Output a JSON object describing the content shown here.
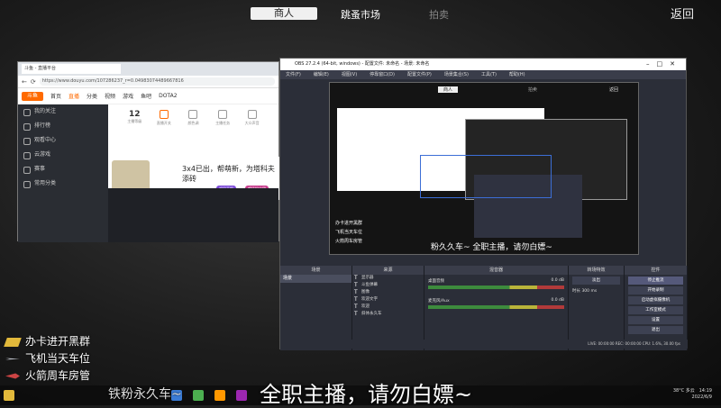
{
  "topbar": {
    "tabs": [
      "商人",
      "跳蚤市场",
      "拍卖"
    ],
    "back": "返回"
  },
  "browser": {
    "tab_title": "斗鱼 - 直播平台",
    "url": "https://www.douyu.com/107286237_r=0.04983074489667816",
    "nav": [
      "首页",
      "直播",
      "分类",
      "视频",
      "游戏",
      "鱼吧",
      "DOTA2"
    ],
    "sidebar": [
      "我的关注",
      "排行榜",
      "观看中心",
      "云游戏",
      "赛事",
      "常用分类"
    ],
    "stats": [
      {
        "num": "12",
        "label": "主播等级"
      },
      {
        "num": "",
        "label": "直播开关"
      },
      {
        "num": "",
        "label": "颜色调"
      },
      {
        "num": "",
        "label": "主播任务"
      },
      {
        "num": "",
        "label": "大众声音"
      }
    ],
    "live_title": "3x4已出，帮萌新，为塔科夫添砖",
    "pills": [
      "福星高照",
      "超级粉丝团"
    ]
  },
  "obs": {
    "title": "OBS 27.2.4 (64-bit, windows) - 配置文件: 未命名 - 场景: 未命名",
    "menu": [
      "文件(F)",
      "编辑(E)",
      "视图(V)",
      "停靠窗口(D)",
      "配置文件(P)",
      "场景集合(S)",
      "工具(T)",
      "帮助(H)"
    ],
    "preview_tabs": [
      "商人",
      "拍卖",
      "返回"
    ],
    "preview_lines": [
      "办卡进开黑群",
      "飞机当天车位",
      "火箭周车房管"
    ],
    "preview_caption": "粉久久车~  全职主播，请勿白嫖~",
    "panels": {
      "scenes": "场景",
      "sources": "来源",
      "mixer": "混音器",
      "transitions": "转场特效",
      "controls": "控件"
    },
    "scene_items": [
      "场景"
    ],
    "source_items": [
      "显示器",
      "斗鱼弹幕",
      "图像",
      "欢迎文字",
      "欢迎",
      "斜体永久车"
    ],
    "mixer_items": [
      {
        "name": "桌面音频",
        "db": "0.0 dB"
      },
      {
        "name": "麦克风/Aux",
        "db": "0.0 dB"
      }
    ],
    "transition": {
      "type": "淡出",
      "duration_label": "时长",
      "duration": "300 ms"
    },
    "controls": [
      "停止推流",
      "开始录制",
      "启动虚拟摄像机",
      "工作室模式",
      "设置",
      "退出"
    ],
    "status": "LIVE: 00:00:00  REC: 00:00:00  CPU: 1.6%, 30.00 fps"
  },
  "overlay": {
    "lines": [
      "办卡进开黑群",
      "飞机当天车位",
      "火箭周车房管"
    ],
    "caption_partial": "铁粉永久车~",
    "caption": "全职主播，请勿白嫖~"
  },
  "taskbar": {
    "temp": "38°C 多云",
    "time": "14:19",
    "date": "2022/6/9"
  }
}
